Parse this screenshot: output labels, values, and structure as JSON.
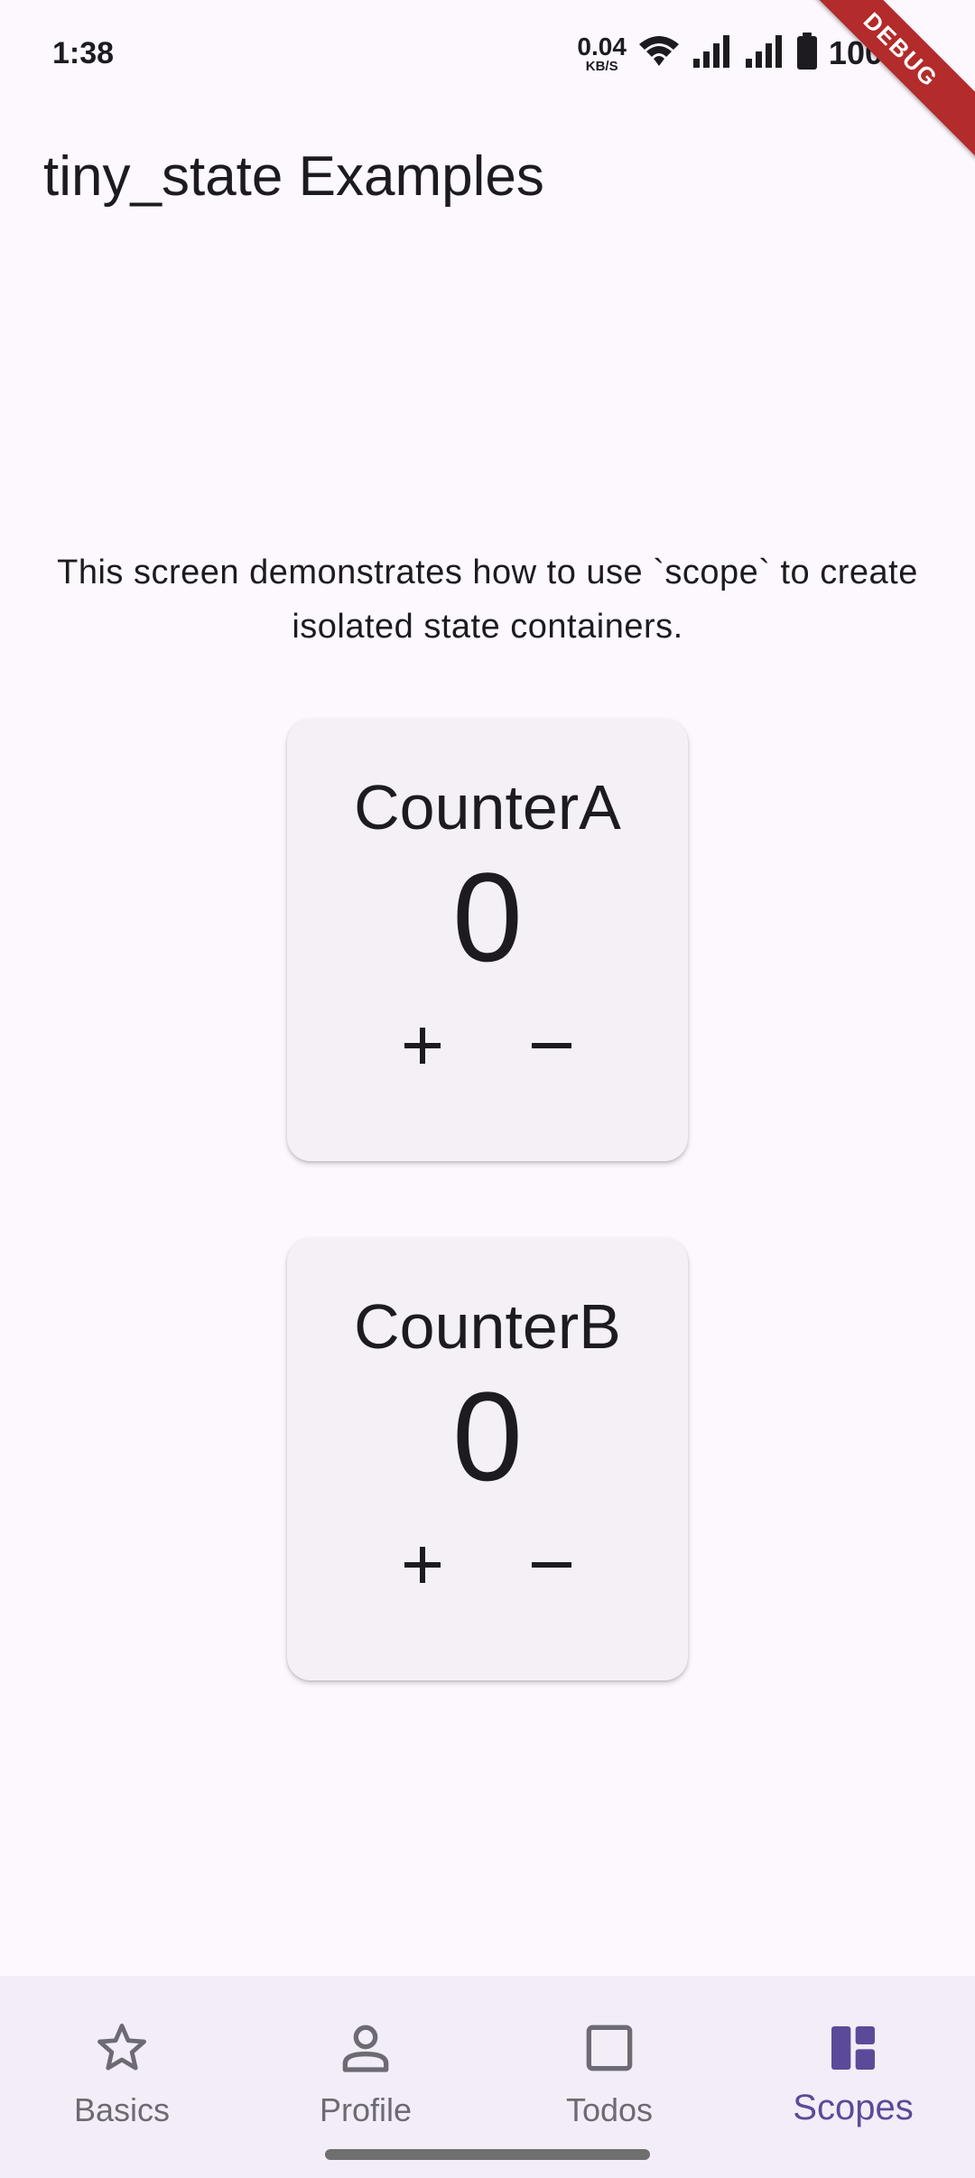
{
  "status_bar": {
    "time": "1:38",
    "net_speed_value": "0.04",
    "net_speed_unit": "KB/S",
    "battery_percent": "100%",
    "icons": [
      "wifi-icon",
      "signal-icon",
      "signal-icon",
      "battery-icon"
    ]
  },
  "debug_banner": "DEBUG",
  "app_bar": {
    "title": "tiny_state Examples"
  },
  "description": "This screen demonstrates how to use `scope` to create isolated state containers.",
  "counters": [
    {
      "name": "CounterA",
      "value": "0",
      "increment_icon": "plus-icon",
      "decrement_icon": "minus-icon"
    },
    {
      "name": "CounterB",
      "value": "0",
      "increment_icon": "plus-icon",
      "decrement_icon": "minus-icon"
    }
  ],
  "bottom_nav": {
    "selected": "Scopes",
    "items": [
      {
        "label": "Basics",
        "icon": "star-icon"
      },
      {
        "label": "Profile",
        "icon": "person-icon"
      },
      {
        "label": "Todos",
        "icon": "square-icon"
      },
      {
        "label": "Scopes",
        "icon": "dashboard-icon"
      }
    ]
  },
  "colors": {
    "background": "#fdf7fe",
    "card": "#f4f0f6",
    "nav_background": "#f3edf7",
    "accent": "#5b4a9a",
    "inactive": "#6e6a73",
    "debug": "#b32b2b"
  }
}
